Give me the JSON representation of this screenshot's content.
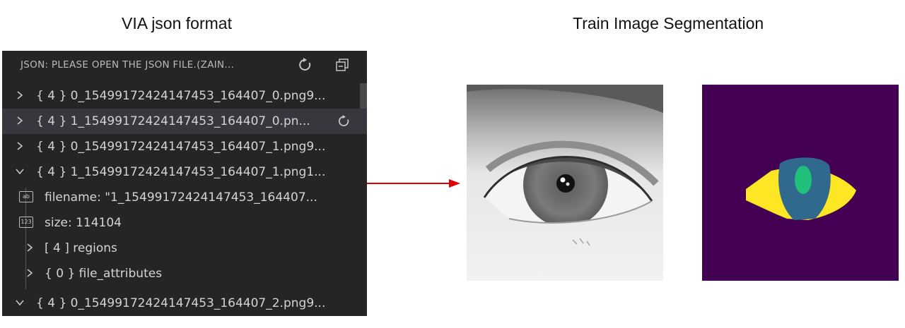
{
  "captions": {
    "left": "VIA json format",
    "right": "Train Image Segmentation"
  },
  "panel": {
    "title": "JSON: PLEASE OPEN THE JSON FILE.(ZAIN...",
    "header_icons": [
      "refresh-icon",
      "collapse-all-icon"
    ],
    "rows": [
      {
        "text": "{ 4 } 0_15499172424147453_164407_0.png9...",
        "expanded": false
      },
      {
        "text": "{ 4 } 1_15499172424147453_164407_0.pn...",
        "expanded": false,
        "selected": true,
        "icon": "refresh-icon"
      },
      {
        "text": "{ 4 } 0_15499172424147453_164407_1.png9...",
        "expanded": false
      },
      {
        "text": "{ 4 } 1_15499172424147453_164407_1.png1...",
        "expanded": true
      },
      {
        "text": "filename: \"1_15499172424147453_164407...",
        "type_icon": "ab"
      },
      {
        "text": "size: 114104",
        "type_icon": "123"
      },
      {
        "text": "[ 4 ] regions",
        "expanded": false
      },
      {
        "text": "{ 0 } file_attributes",
        "expanded": false
      },
      {
        "text": "{ 4 } 0_15499172424147453_164407_2.png9...",
        "expanded": true
      }
    ]
  },
  "colors": {
    "panel_bg": "#252526",
    "selected_row": "#37373d",
    "arrow": "#e00000",
    "mask_background": "#440154",
    "mask_sclera": "#fde725",
    "mask_iris": "#31688e",
    "mask_pupil": "#20c07a"
  }
}
